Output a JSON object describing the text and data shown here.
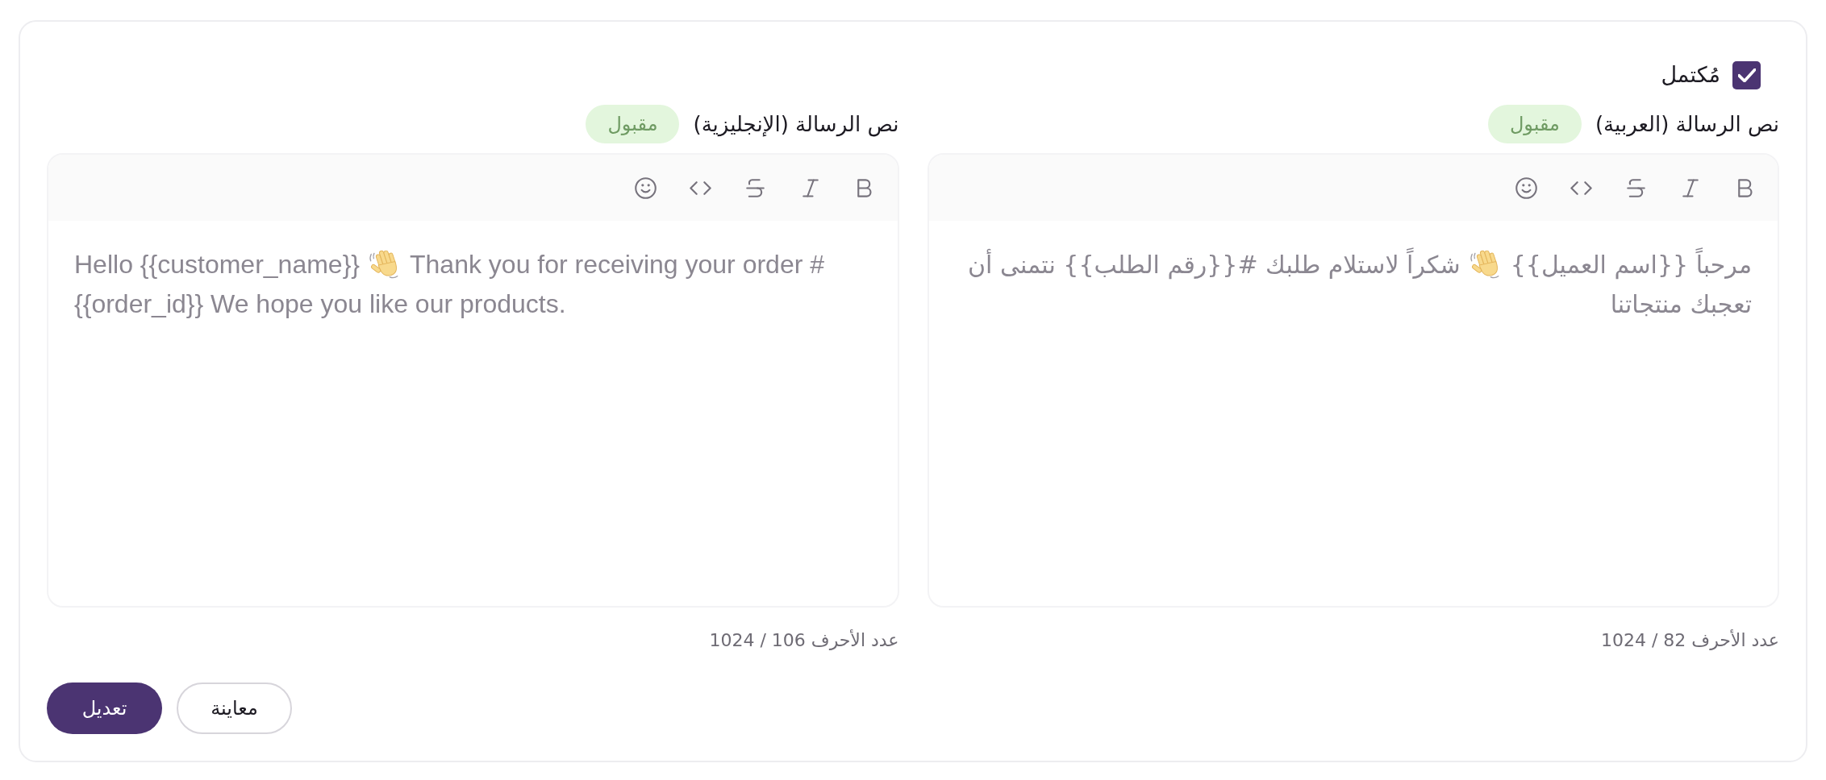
{
  "completion": {
    "label": "مُكتمل",
    "checked": true
  },
  "editors": [
    {
      "label": "نص الرسالة (العربية)",
      "badge": "مقبول",
      "kind": "rtl",
      "content": [
        {
          "kind": "text",
          "text": "مرحباً {{اسم العميل}}"
        },
        {
          "kind": "emoji"
        },
        {
          "kind": "text",
          "text": "شكراً لاستلام طلبك #{{رقم الطلب}} نتمنى أن تعجبك منتجاتنا"
        }
      ],
      "char_count": "عدد الأحرف 82 / 1024"
    },
    {
      "label": "نص الرسالة (الإنجليزية)",
      "badge": "مقبول",
      "kind": "ltr",
      "content": [
        {
          "kind": "text",
          "text": "Hello {{customer_name}}"
        },
        {
          "kind": "emoji"
        },
        {
          "kind": "text",
          "text": "Thank you for receiving your order #{{order_id}} We hope you like our products."
        }
      ],
      "char_count": "عدد الأحرف 106 / 1024"
    }
  ],
  "buttons": [
    {
      "label": "معاينة",
      "kind": "secondary"
    },
    {
      "label": "تعديل",
      "kind": "primary"
    }
  ]
}
